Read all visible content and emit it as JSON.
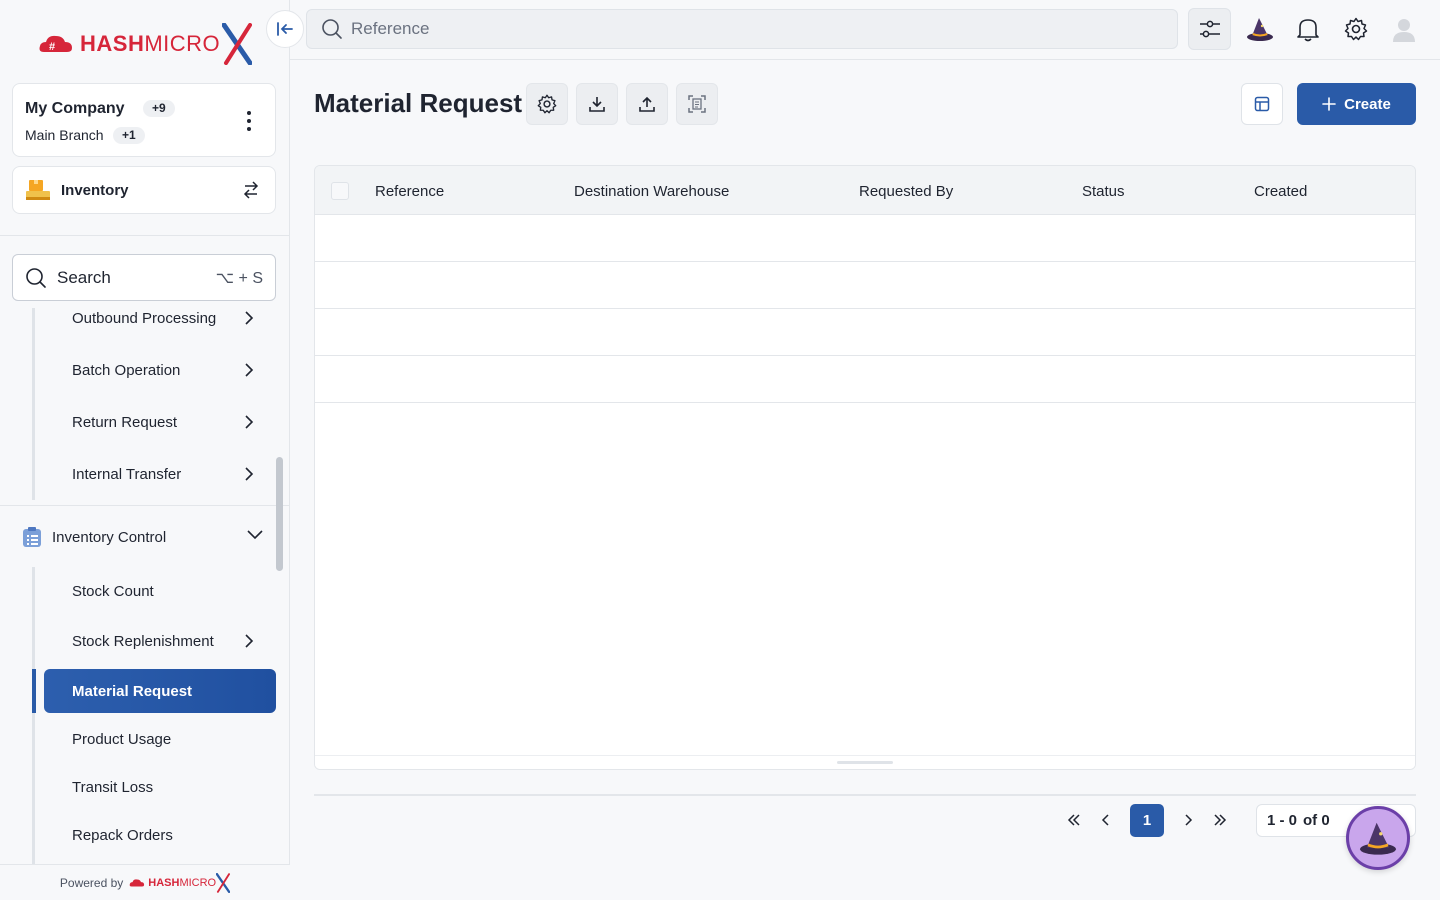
{
  "brand": {
    "name_bold": "HASH",
    "name_thin": "MICRO",
    "accent": "#d6263a",
    "x_color_1": "#2a5ba8",
    "x_color_2": "#d6263a"
  },
  "company": {
    "name": "My Company",
    "name_badge": "+9",
    "branch": "Main Branch",
    "branch_badge": "+1"
  },
  "module": {
    "label": "Inventory",
    "icon": "inventory-icon"
  },
  "sidebar_search": {
    "label": "Search",
    "shortcut": "⌥ + S"
  },
  "menu": {
    "outbound": "Outbound Processing",
    "batch": "Batch Operation",
    "return_request": "Return Request",
    "internal_transfer": "Internal Transfer",
    "section_inventory_control": "Inventory Control",
    "stock_count": "Stock Count",
    "stock_replenishment": "Stock Replenishment",
    "material_request": "Material Request",
    "product_usage": "Product Usage",
    "transit_loss": "Transit Loss",
    "repack_orders": "Repack Orders"
  },
  "powered": {
    "label": "Powered by"
  },
  "topbar": {
    "search_placeholder": "Reference"
  },
  "page": {
    "title": "Material Request",
    "create_label": "Create"
  },
  "table": {
    "columns": [
      "Reference",
      "Destination Warehouse",
      "Requested By",
      "Status",
      "Created"
    ],
    "rows": []
  },
  "pagination": {
    "current_page": "1",
    "range": "1 - 0",
    "of_label": "of 0"
  },
  "colors": {
    "primary": "#2a5ba8",
    "sidebar_bg": "#f7f8fa",
    "border": "#e3e6ea"
  }
}
